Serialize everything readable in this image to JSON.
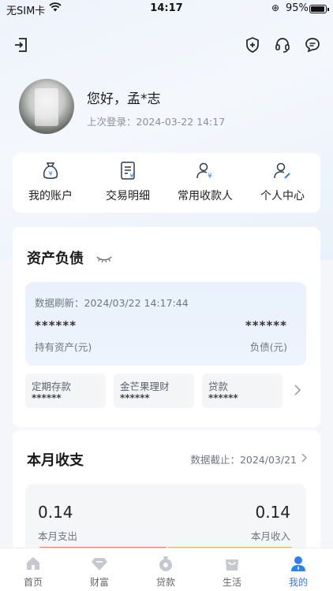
{
  "status_bar": {
    "carrier": "无SIM卡",
    "time": "14:17",
    "battery": "95%"
  },
  "profile": {
    "greeting": "您好，孟*志",
    "last_login": "上次登录：2024-03-22 14:17"
  },
  "shortcuts": [
    {
      "label": "我的账户",
      "icon": "money-bag-icon"
    },
    {
      "label": "交易明细",
      "icon": "transaction-list-icon"
    },
    {
      "label": "常用收款人",
      "icon": "payee-icon"
    },
    {
      "label": "个人中心",
      "icon": "personal-center-icon"
    }
  ],
  "assets": {
    "title": "资产负债",
    "refresh": "数据刷新：2024/03/22 14:17:44",
    "assets_value": "******",
    "assets_label": "持有资产(元)",
    "debt_value": "******",
    "debt_label": "负债(元)",
    "items": [
      {
        "label": "定期存款",
        "value": "******"
      },
      {
        "label": "金芒果理财",
        "value": "******"
      },
      {
        "label": "贷款",
        "value": "******"
      }
    ]
  },
  "monthly": {
    "title": "本月收支",
    "cutoff": "数据截止：2024/03/21",
    "spend_value": "0.14",
    "spend_label": "本月支出",
    "income_value": "0.14",
    "income_label": "本月收入",
    "spend_color": "#e87a67",
    "income_color": "#d9b17a"
  },
  "tabs": [
    {
      "label": "首页",
      "icon": "home-icon"
    },
    {
      "label": "财富",
      "icon": "wealth-icon"
    },
    {
      "label": "贷款",
      "icon": "loan-icon"
    },
    {
      "label": "生活",
      "icon": "shopping-bag-icon"
    },
    {
      "label": "我的",
      "icon": "profile-icon",
      "active": true
    }
  ],
  "accent_color": "#2f7ef3"
}
